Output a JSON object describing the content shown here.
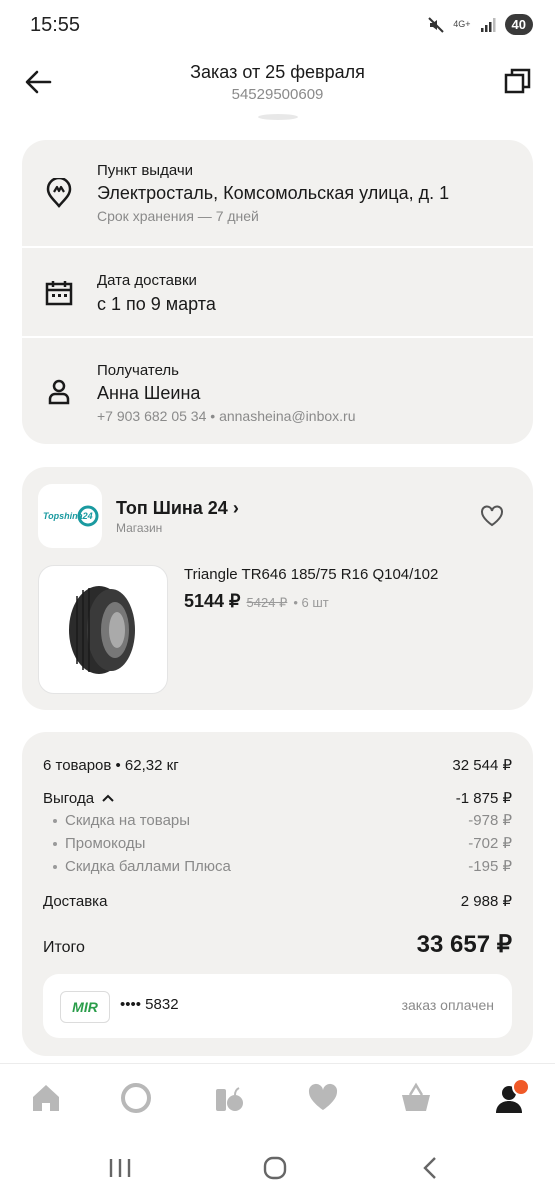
{
  "status_bar": {
    "time": "15:55",
    "network": "4G+",
    "battery": "40"
  },
  "header": {
    "title": "Заказ от 25 февраля",
    "order_number": "54529500609"
  },
  "pickup": {
    "label": "Пункт выдачи",
    "address": "Электросталь, Комсомольская улица, д. 1",
    "storage": "Срок хранения — 7 дней"
  },
  "delivery": {
    "label": "Дата доставки",
    "dates": "с 1 по 9 марта"
  },
  "recipient": {
    "label": "Получатель",
    "name": "Анна Шеина",
    "contacts": "+7 903 682 05 34 • annasheina@inbox.ru"
  },
  "shop": {
    "name": "Топ Шина 24",
    "arrow": "›",
    "type": "Магазин",
    "logo_text": "Topshina24"
  },
  "product": {
    "name": "Triangle TR646 185/75 R16 Q104/102",
    "price": "5144 ₽",
    "old_price": "5424 ₽",
    "quantity": "• 6 шт"
  },
  "summary": {
    "items_label": "6 товаров • 62,32 кг",
    "items_value": "32 544 ₽",
    "benefit_label": "Выгода",
    "benefit_value": "-1 875 ₽",
    "discounts": [
      {
        "label": "Скидка на товары",
        "value": "-978 ₽"
      },
      {
        "label": "Промокоды",
        "value": "-702 ₽"
      },
      {
        "label": "Скидка баллами Плюса",
        "value": "-195 ₽"
      }
    ],
    "delivery_label": "Доставка",
    "delivery_value": "2 988 ₽",
    "total_label": "Итого",
    "total_value": "33 657 ₽"
  },
  "payment": {
    "system": "MIR",
    "card": "•••• 5832",
    "status": "заказ оплачен"
  },
  "bottom_nav": [
    "home-icon",
    "alice-icon",
    "catalog-icon",
    "favorites-icon",
    "cart-icon",
    "profile-icon"
  ],
  "colors": {
    "card_bg": "#f2f1ef",
    "accent": "#f05a28",
    "mir_green": "#2a9d4a",
    "logo_teal": "#1a9aa0"
  }
}
